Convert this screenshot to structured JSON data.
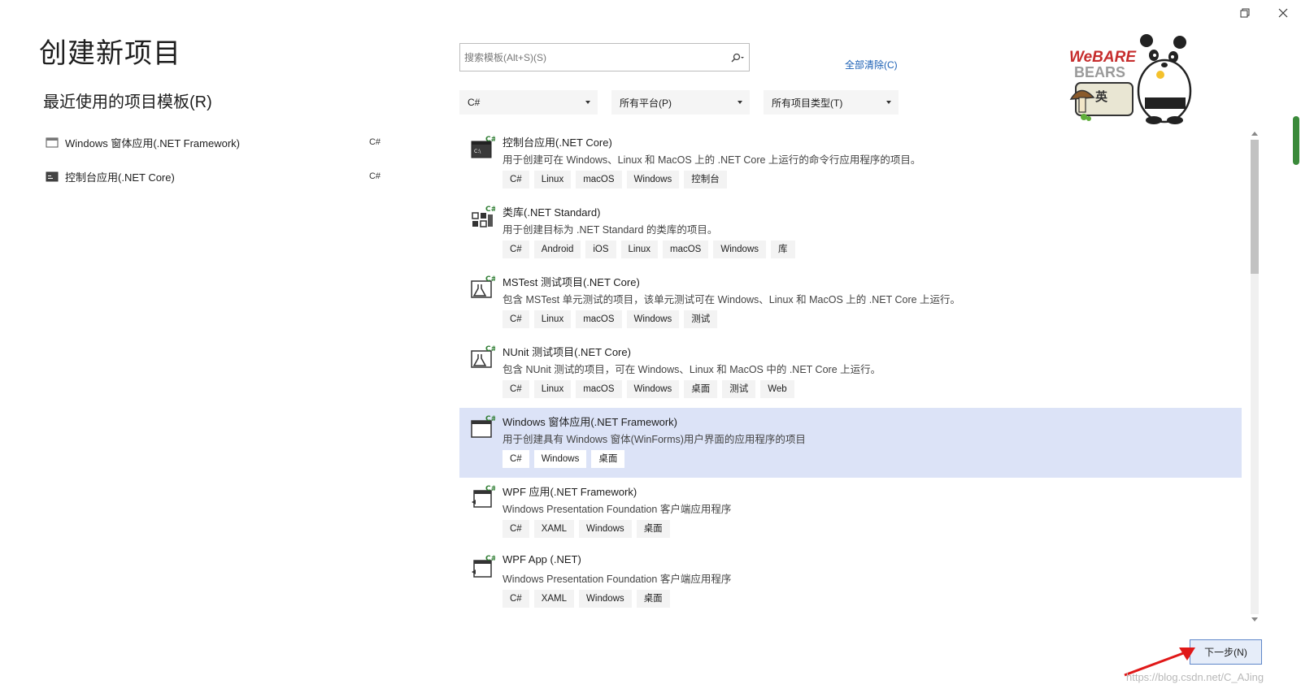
{
  "window": {
    "restore_icon": "restore-icon",
    "close_icon": "close-icon"
  },
  "page_title": "创建新项目",
  "recent": {
    "title": "最近使用的项目模板(R)",
    "items": [
      {
        "label": "Windows 窗体应用(.NET Framework)",
        "lang": "C#",
        "icon": "windows-form-icon"
      },
      {
        "label": "控制台应用(.NET Core)",
        "lang": "C#",
        "icon": "console-app-icon"
      }
    ]
  },
  "search": {
    "placeholder": "搜索模板(Alt+S)(S)",
    "value": ""
  },
  "clear_all": "全部清除(C)",
  "filters": {
    "language": "C#",
    "platform": "所有平台(P)",
    "project_type": "所有项目类型(T)"
  },
  "logo": {
    "text_top": "WeBARE",
    "text_bottom": "BEARS",
    "badge": "英"
  },
  "templates": [
    {
      "name": "控制台应用(.NET Core)",
      "desc": "用于创建可在 Windows、Linux 和 MacOS 上的 .NET Core 上运行的命令行应用程序的项目。",
      "tags": [
        "C#",
        "Linux",
        "macOS",
        "Windows",
        "控制台"
      ],
      "icon": "console-template-icon",
      "selected": false
    },
    {
      "name": "类库(.NET Standard)",
      "desc": "用于创建目标为 .NET Standard 的类库的项目。",
      "tags": [
        "C#",
        "Android",
        "iOS",
        "Linux",
        "macOS",
        "Windows",
        "库"
      ],
      "icon": "class-library-icon",
      "selected": false
    },
    {
      "name": "MSTest 测试项目(.NET Core)",
      "desc": "包含 MSTest 单元测试的项目，该单元测试可在 Windows、Linux 和 MacOS 上的 .NET Core 上运行。",
      "tags": [
        "C#",
        "Linux",
        "macOS",
        "Windows",
        "测试"
      ],
      "icon": "test-project-icon",
      "selected": false
    },
    {
      "name": "NUnit 测试项目(.NET Core)",
      "desc": "包含 NUnit 测试的项目，可在 Windows、Linux 和 MacOS 中的 .NET Core 上运行。",
      "tags": [
        "C#",
        "Linux",
        "macOS",
        "Windows",
        "桌面",
        "测试",
        "Web"
      ],
      "icon": "test-project-icon",
      "selected": false
    },
    {
      "name": "Windows 窗体应用(.NET Framework)",
      "desc": "用于创建具有 Windows 窗体(WinForms)用户界面的应用程序的项目",
      "tags": [
        "C#",
        "Windows",
        "桌面"
      ],
      "icon": "windows-form-template-icon",
      "selected": true
    },
    {
      "name": "WPF 应用(.NET Framework)",
      "desc": "Windows Presentation Foundation 客户端应用程序",
      "tags": [
        "C#",
        "XAML",
        "Windows",
        "桌面"
      ],
      "icon": "wpf-app-icon",
      "selected": false
    },
    {
      "name": "WPF App (.NET)",
      "desc": "Windows Presentation Foundation 客户端应用程序",
      "tags": [
        "C#",
        "XAML",
        "Windows",
        "桌面"
      ],
      "icon": "wpf-app-icon",
      "selected": false
    }
  ],
  "next_button": "下一步(N)",
  "watermark": "https://blog.csdn.net/C_AJing",
  "colors": {
    "selected_bg": "#dce3f7",
    "link": "#1a5fb4",
    "button_border": "#5f87c9",
    "arrow": "#e01818"
  }
}
